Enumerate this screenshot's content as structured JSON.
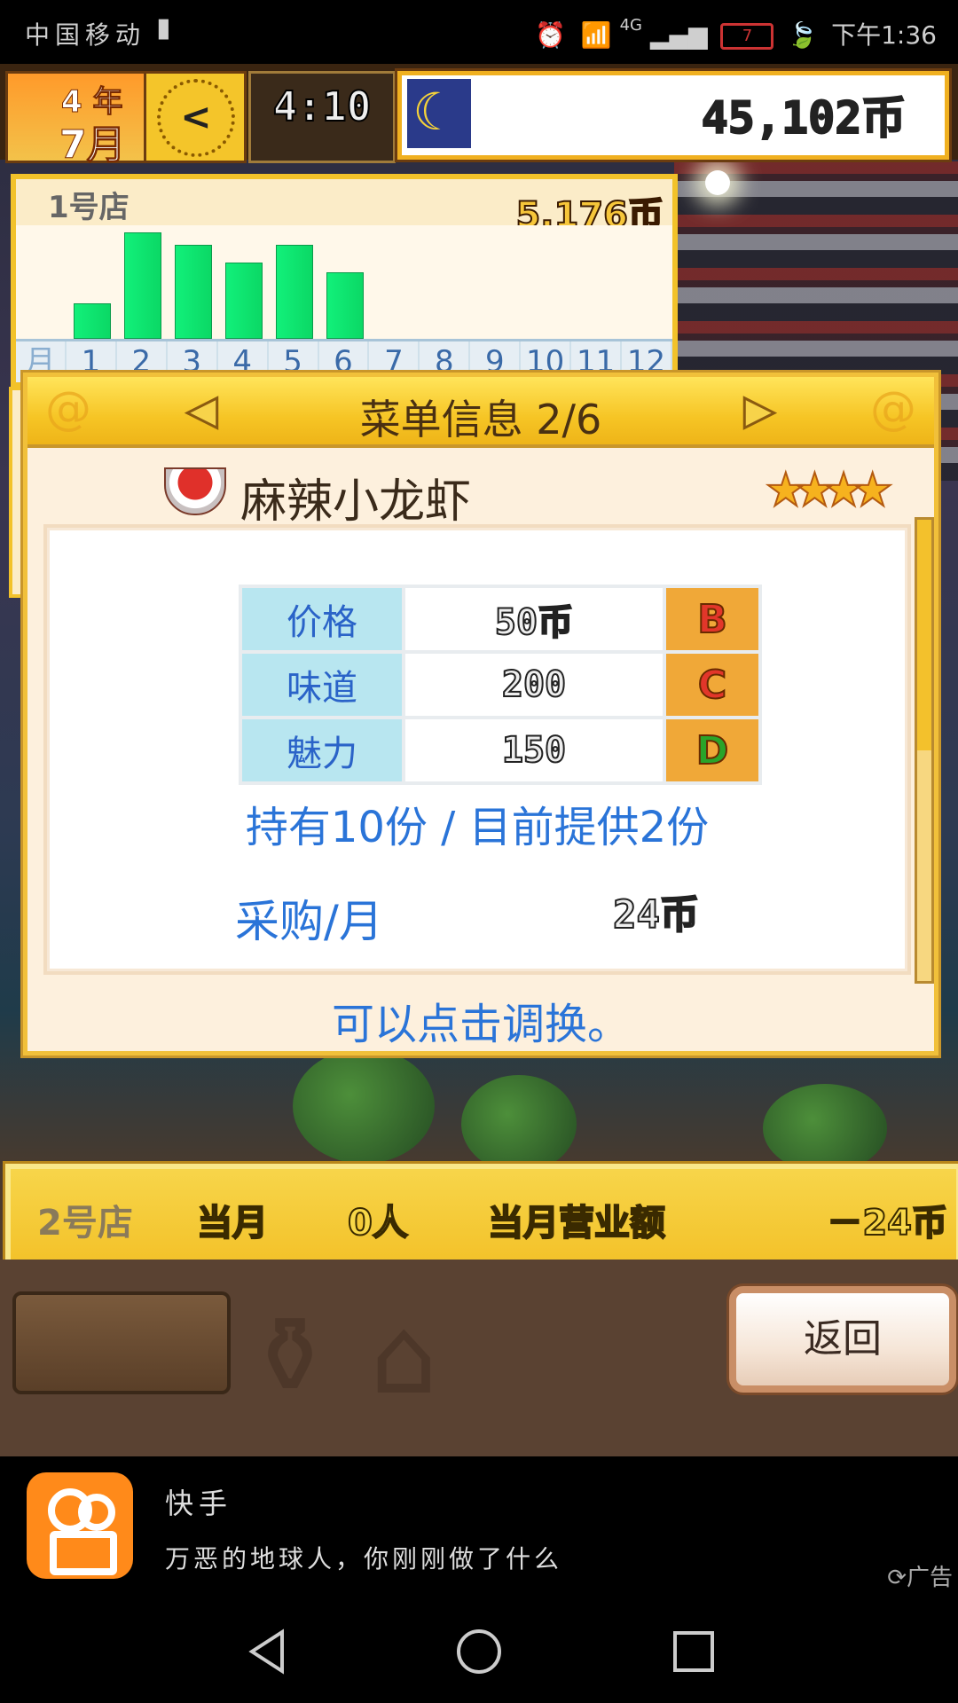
{
  "status_bar": {
    "carrier": "中国移动",
    "battery": "7",
    "time": "下午1:36",
    "network": "4G"
  },
  "hud": {
    "year": "4 年",
    "month": "7月",
    "clock_symbol": "<",
    "time": "4:10",
    "money": "45,102币"
  },
  "store1": {
    "title": "1号店",
    "revenue": "5,176币",
    "axis_first": "月",
    "months": [
      "1",
      "2",
      "3",
      "4",
      "5",
      "6",
      "7",
      "8",
      "9",
      "10",
      "11",
      "12"
    ],
    "chart_data": {
      "type": "bar",
      "categories": [
        "1",
        "2",
        "3",
        "4",
        "5",
        "6",
        "7",
        "8",
        "9",
        "10",
        "11",
        "12"
      ],
      "values": [
        30,
        92,
        81,
        66,
        81,
        57,
        0,
        0,
        0,
        0,
        0,
        0
      ],
      "ylim": [
        0,
        100
      ]
    }
  },
  "dialog": {
    "title": "菜单信息 2/6",
    "dish_name": "麻辣小龙虾",
    "stars": "★★★★",
    "stats": [
      {
        "label": "价格",
        "value": "50币",
        "grade": "B",
        "grade_color": "#e2362a"
      },
      {
        "label": "味道",
        "value": "200",
        "grade": "C",
        "grade_color": "#e2362a"
      },
      {
        "label": "魅力",
        "value": "150",
        "grade": "D",
        "grade_color": "#2aa42a"
      }
    ],
    "holding": "持有10份 / 目前提供2份",
    "purchase_label": "采购/月",
    "purchase_value": "24币",
    "hint": "可以点击调换。"
  },
  "store2": {
    "title": "2号店",
    "month_label": "当月",
    "customers": "0人",
    "sales_label": "当月营业额",
    "sales": "－24币"
  },
  "bottom": {
    "back_label": "返回"
  },
  "ad": {
    "app_name": "快手",
    "text": "万恶的地球人，你刚刚做了什么",
    "tag": "广告"
  },
  "colors": {
    "accent_yellow": "#f3c22a",
    "text_blue": "#2a74d8",
    "bar_green": "#12f07a"
  }
}
